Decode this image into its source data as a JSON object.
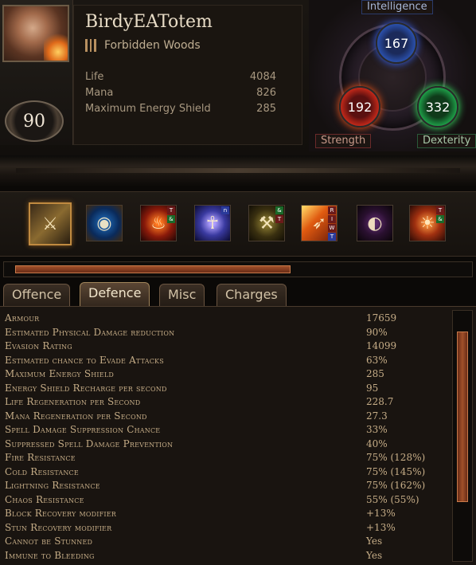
{
  "character": {
    "name": "BirdyEATotem",
    "league": "Forbidden Woods",
    "level": "90"
  },
  "vitals": [
    {
      "label": "Life",
      "value": "4084"
    },
    {
      "label": "Mana",
      "value": "826"
    },
    {
      "label": "Maximum Energy Shield",
      "value": "285"
    }
  ],
  "attributes": {
    "intelligence": {
      "label": "Intelligence",
      "value": "167",
      "color": "#2d56b8"
    },
    "strength": {
      "label": "Strength",
      "value": "192",
      "color": "#c82a1a"
    },
    "dexterity": {
      "label": "Dexterity",
      "value": "332",
      "color": "#1fa24a"
    }
  },
  "skills": [
    {
      "icon": "sword-icon",
      "tags": []
    },
    {
      "icon": "blue-shield-icon",
      "tags": []
    },
    {
      "icon": "fire-totem-icon",
      "tags": [
        "T",
        "&"
      ]
    },
    {
      "icon": "spirit-figure-icon",
      "tags": [
        "n"
      ]
    },
    {
      "icon": "warrior-icon",
      "tags": [
        "&",
        "T"
      ]
    },
    {
      "icon": "fire-arrow-icon",
      "tags": [
        "R",
        "I",
        "W",
        "T"
      ]
    },
    {
      "icon": "dark-arc-icon",
      "tags": []
    },
    {
      "icon": "war-cry-icon",
      "tags": [
        "T",
        "&"
      ]
    }
  ],
  "tabs": [
    {
      "label": "Offence"
    },
    {
      "label": "Defence"
    },
    {
      "label": "Misc"
    },
    {
      "label": "Charges"
    }
  ],
  "active_tab": "Defence",
  "stats": [
    {
      "name": "Armour",
      "value": "17659"
    },
    {
      "name": "Estimated Physical Damage reduction",
      "value": "90%"
    },
    {
      "name": "Evasion Rating",
      "value": "14099"
    },
    {
      "name": "Estimated chance to Evade Attacks",
      "value": "63%"
    },
    {
      "name": "Maximum Energy Shield",
      "value": "285"
    },
    {
      "name": "Energy Shield Recharge per second",
      "value": "95"
    },
    {
      "name": "Life Regeneration per Second",
      "value": "228.7"
    },
    {
      "name": "Mana Regeneration per Second",
      "value": "27.3"
    },
    {
      "name": "Spell Damage Suppression Chance",
      "value": "33%"
    },
    {
      "name": "Suppressed Spell Damage Prevention",
      "value": "40%"
    },
    {
      "name": "Fire Resistance",
      "value": "75% (128%)"
    },
    {
      "name": "Cold Resistance",
      "value": "75% (145%)"
    },
    {
      "name": "Lightning Resistance",
      "value": "75% (162%)"
    },
    {
      "name": "Chaos Resistance",
      "value": "55% (55%)"
    },
    {
      "name": "Block Recovery modifier",
      "value": "+13%"
    },
    {
      "name": "Stun Recovery modifier",
      "value": "+13%"
    },
    {
      "name": "Cannot be Stunned",
      "value": "Yes"
    },
    {
      "name": "Immune to Bleeding",
      "value": "Yes"
    }
  ]
}
